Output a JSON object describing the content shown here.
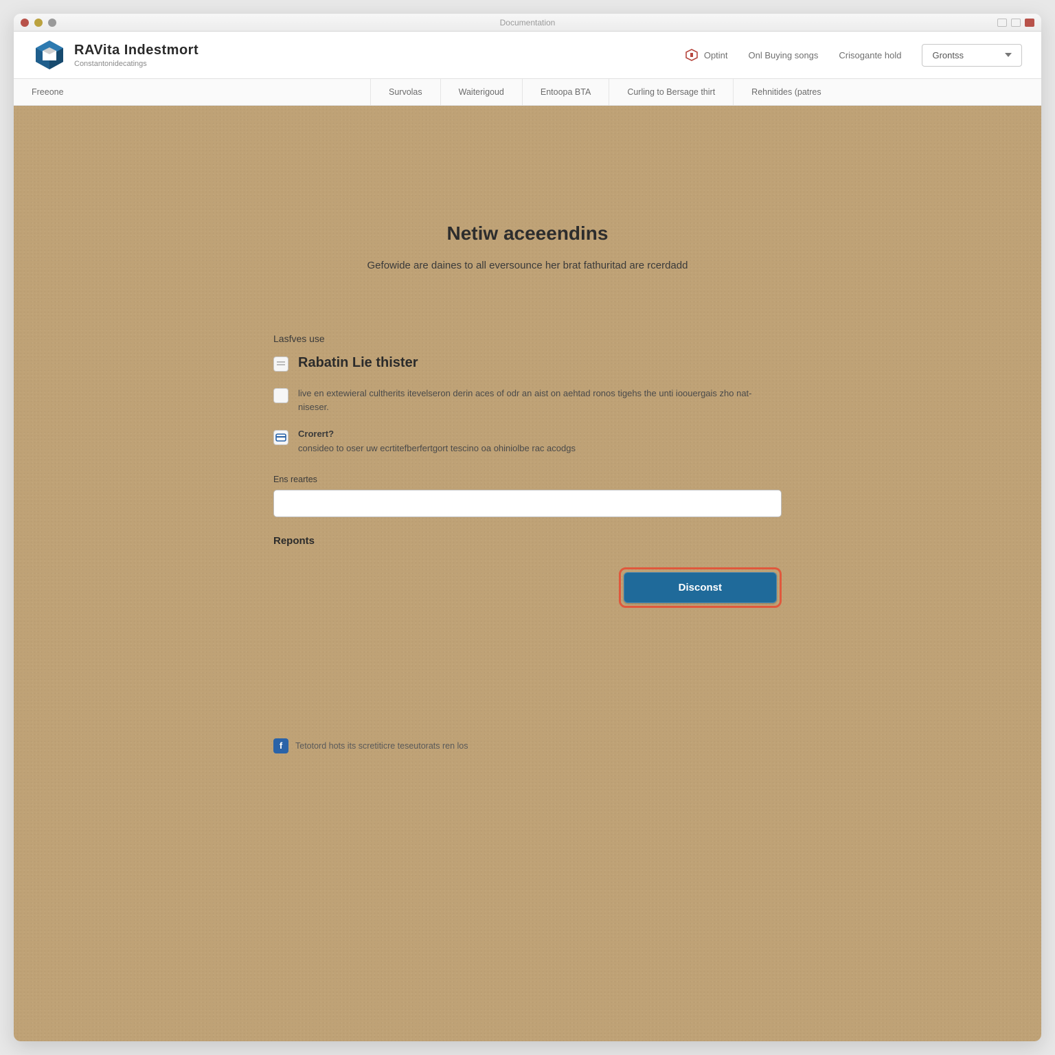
{
  "window": {
    "title": "Documentation"
  },
  "brand": {
    "title": "RAVita Indestmort",
    "subtitle": "Constantonidecatings"
  },
  "headerLinks": {
    "optint": "Optint",
    "buyingSongs": "Onl Buying songs",
    "crisogante": "Crisogante hold"
  },
  "langSelect": {
    "label": "Grontss"
  },
  "nav": {
    "item0": "Freeone",
    "item1": "Survolas",
    "item2": "Waiterigoud",
    "item3": "Entoopa BTA",
    "item4": "Curling to Bersage thirt",
    "item5": "Rehnitides (patres"
  },
  "page": {
    "title": "Netiw aceeendins",
    "subtitle": "Gefowide are daines to all eversounce her brat fathuritad are rcerdadd"
  },
  "form": {
    "sectionLabel": "Lasfves use",
    "option1": {
      "title": "Rabatin Lie thister"
    },
    "option2": {
      "desc": "live en extewieral cultherits itevelseron derin aces of odr an aist on aehtad ronos tigehs the unti ioouergais zho nat-niseser."
    },
    "option3": {
      "title": "Crorert?",
      "desc": "consideo to oser uw ecrtitefberfertgort tescino oa ohiniolbe rac acodgs"
    },
    "fieldLabel": "Ens reartes",
    "inputValue": "",
    "reportsLabel": "Reponts",
    "submitLabel": "Disconst"
  },
  "footer": {
    "note": "Tetotord hots its scretiticre teseutorats ren los"
  }
}
